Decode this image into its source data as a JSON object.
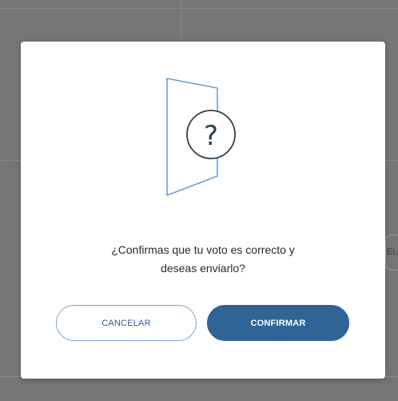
{
  "background": {
    "side_chip_text": "ELE"
  },
  "dialog": {
    "icon": "door-question-icon",
    "question_symbol": "?",
    "message_line1": "¿Confirmas que tu voto es correcto y",
    "message_line2": "deseas enviarlo?",
    "cancel_label": "CANCELAR",
    "confirm_label": "CONFIRMAR"
  },
  "colors": {
    "primary": "#2e6496",
    "outline": "#7ea7d0",
    "illustration_line": "#6e9fd0",
    "circle_stroke": "#2d4150",
    "overlay": "#767676"
  }
}
